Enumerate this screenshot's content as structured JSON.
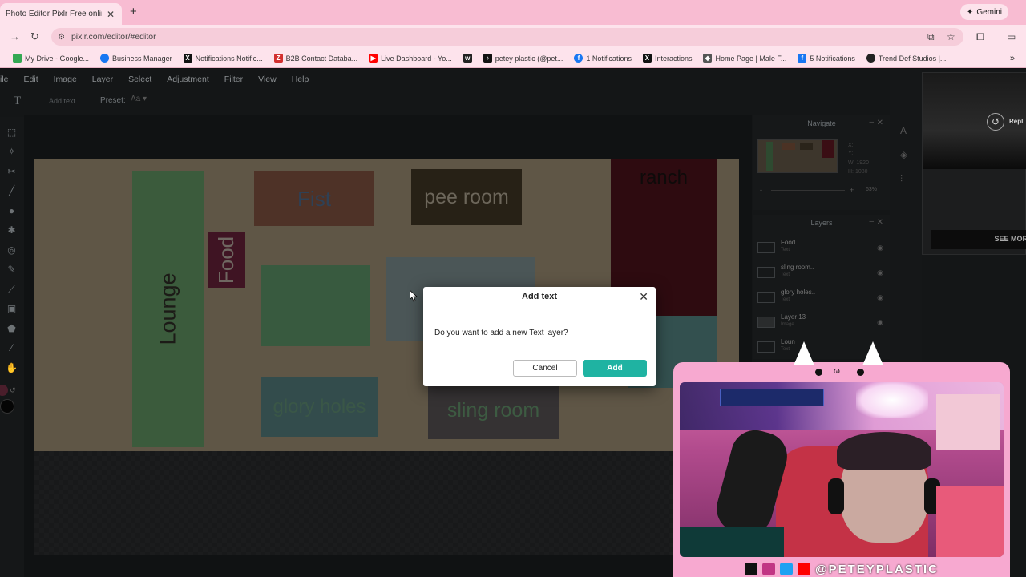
{
  "browser": {
    "tab_title": "Photo Editor Pixlr Free online Ir",
    "gemini_label": "Gemini",
    "url": "pixlr.com/editor/#editor",
    "bookmarks": [
      {
        "label": "My Drive - Google...",
        "color": "#34a853"
      },
      {
        "label": "Business Manager",
        "color": "#1877f2"
      },
      {
        "label": "Notifications Notific...",
        "color": "#111111"
      },
      {
        "label": "B2B Contact Databa...",
        "color": "#d32f2f"
      },
      {
        "label": "Live Dashboard - Yo...",
        "color": "#ff0000"
      },
      {
        "label": "",
        "color": "#222222"
      },
      {
        "label": "petey plastic (@pet...",
        "color": "#111111"
      },
      {
        "label": "1 Notifications",
        "color": "#1877f2"
      },
      {
        "label": "Interactions",
        "color": "#111111"
      },
      {
        "label": "Home Page | Male F...",
        "color": "#555555"
      },
      {
        "label": "5 Notifications",
        "color": "#1877f2"
      },
      {
        "label": "Trend Def Studios |...",
        "color": "#222222"
      }
    ]
  },
  "menu": [
    "ile",
    "Edit",
    "Image",
    "Layer",
    "Select",
    "Adjustment",
    "Filter",
    "View",
    "Help"
  ],
  "options": {
    "add_text_label": "Add text",
    "preset_label": "Preset:"
  },
  "canvas_rooms": {
    "lounge": "Lounge",
    "food": "Food",
    "fist": "Fist",
    "pee_room": "pee room",
    "ranch": "ranch",
    "glory_holes": "glory holes",
    "sling_room": "sling room"
  },
  "navigate": {
    "title": "Navigate",
    "x_label": "X:",
    "y_label": "Y:",
    "w_label": "W:",
    "w_value": "1920",
    "h_label": "H:",
    "h_value": "1080",
    "zoom": "63%",
    "minus": "-",
    "plus": "+"
  },
  "layers": {
    "title": "Layers",
    "items": [
      {
        "name": "Food..",
        "sub": "Text"
      },
      {
        "name": "sling room..",
        "sub": "Text"
      },
      {
        "name": "glory holes..",
        "sub": "Text"
      },
      {
        "name": "Layer 13",
        "sub": "Image"
      },
      {
        "name": "Loun",
        "sub": "Text"
      }
    ]
  },
  "ad": {
    "replay": "Repl",
    "see_more": "SEE MOR"
  },
  "dialog": {
    "title": "Add text",
    "message": "Do you want to add a new Text layer?",
    "cancel": "Cancel",
    "add": "Add"
  },
  "webcam": {
    "handle": "@PETEYPLASTIC"
  },
  "colors": {
    "accent": "#1fb3a2",
    "browser_pink": "#f8bcd2",
    "cam_pink": "#f7a9d0"
  }
}
